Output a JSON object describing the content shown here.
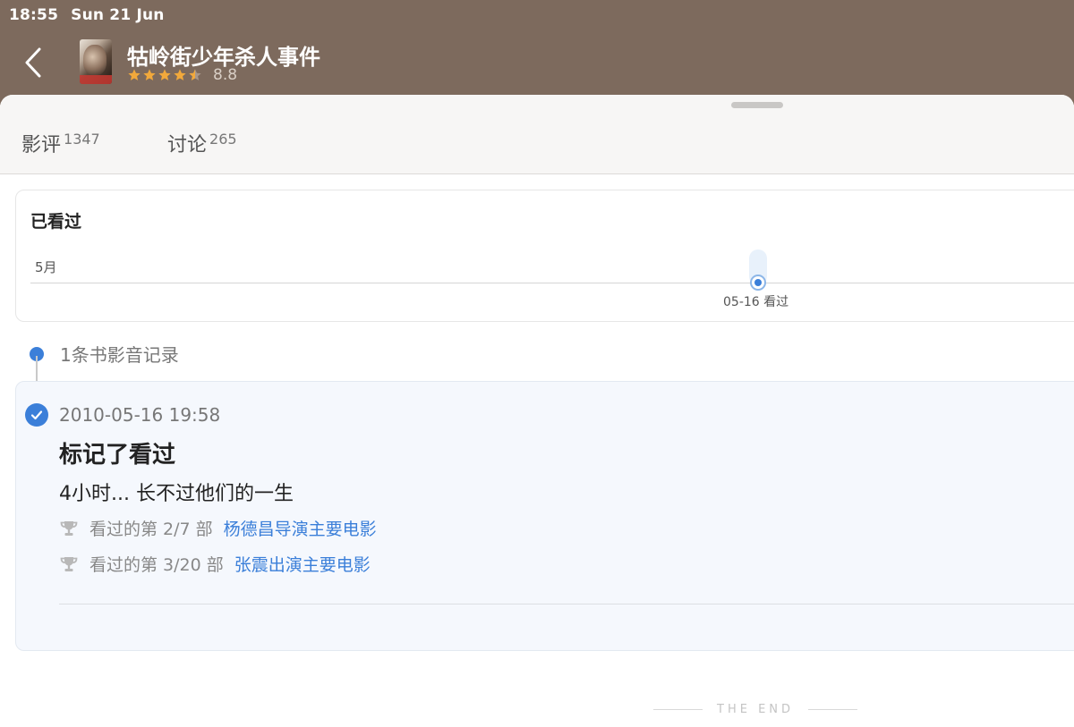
{
  "status_bar": {
    "time": "18:55",
    "date": "Sun 21 Jun"
  },
  "header": {
    "title": "牯岭街少年杀人事件",
    "rating": "8.8",
    "stars": 4.5,
    "colors": {
      "header_bg": "#7d6a5d",
      "star": "#f2a93b"
    }
  },
  "tabs": [
    {
      "label": "影评",
      "count": "1347"
    },
    {
      "label": "讨论",
      "count": "265"
    }
  ],
  "watched": {
    "title": "已看过",
    "month": "5月",
    "mark_label": "05-16 看过"
  },
  "records": {
    "count_label": "1条书影音记录",
    "items": [
      {
        "time": "2010-05-16 19:58",
        "action": "标记了看过",
        "comment": "4小时... 长不过他们的一生",
        "achievements": [
          {
            "text": "看过的第 2/7 部",
            "link": "杨德昌导演主要电影"
          },
          {
            "text": "看过的第 3/20 部",
            "link": "张震出演主要电影"
          }
        ]
      }
    ]
  },
  "footer": {
    "end_text": "THE END"
  },
  "accent_color": "#3b7fd9"
}
